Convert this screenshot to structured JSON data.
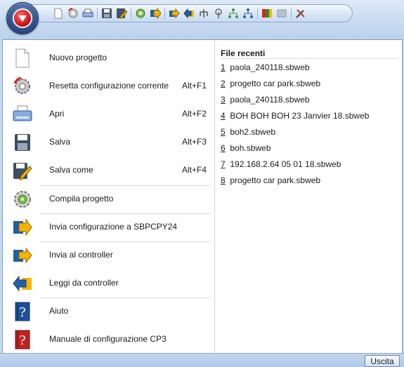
{
  "menu": {
    "items": [
      {
        "label": "Nuovo progetto",
        "shortcut": "",
        "icon": "new-document-icon"
      },
      {
        "label": "Resetta configurazione corrente",
        "shortcut": "Alt+F1",
        "icon": "reset-gear-icon"
      },
      {
        "label": "Apri",
        "shortcut": "Alt+F2",
        "icon": "open-printer-icon"
      },
      {
        "label": "Salva",
        "shortcut": "Alt+F3",
        "icon": "floppy-disk-icon"
      },
      {
        "label": "Salva come",
        "shortcut": "Alt+F4",
        "icon": "save-as-pencil-icon"
      },
      {
        "label": "Compila progetto",
        "shortcut": "",
        "icon": "compile-gear-icon"
      },
      {
        "label": "Invia configurazione a SBPCPY24",
        "shortcut": "",
        "icon": "send-config-icon"
      },
      {
        "label": "Invia al controller",
        "shortcut": "",
        "icon": "send-arrow-icon"
      },
      {
        "label": "Leggi da controller",
        "shortcut": "",
        "icon": "read-arrow-icon"
      },
      {
        "label": "Aiuto",
        "shortcut": "",
        "icon": "help-book-icon"
      },
      {
        "label": "Manuale di configurazione CP3",
        "shortcut": "",
        "icon": "manual-book-icon"
      }
    ]
  },
  "recent": {
    "title": "File recenti",
    "files": [
      {
        "num": "1",
        "name": "paola_240118.sbweb"
      },
      {
        "num": "2",
        "name": "progetto car park.sbweb"
      },
      {
        "num": "3",
        "name": "paola_240118.sbweb"
      },
      {
        "num": "4",
        "name": "BOH BOH BOH 23 Janvier 18.sbweb"
      },
      {
        "num": "5",
        "name": "boh2.sbweb"
      },
      {
        "num": "6",
        "name": "boh.sbweb"
      },
      {
        "num": "7",
        "name": "192.168.2.64 05 01 18.sbweb"
      },
      {
        "num": "8",
        "name": "progetto car park.sbweb"
      }
    ]
  },
  "footer": {
    "exit_label": "Uscita"
  },
  "colors": {
    "accent": "#2f4f8a",
    "logo": "#d01818",
    "frame": "#c6d9f0"
  }
}
